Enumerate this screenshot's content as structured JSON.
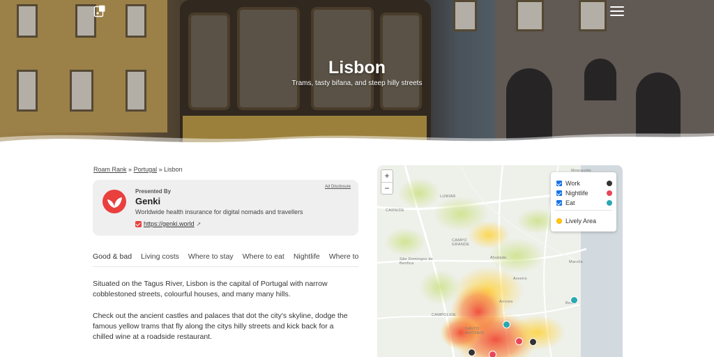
{
  "hero": {
    "title": "Lisbon",
    "subtitle": "Trams, tasty bifana, and steep hilly streets"
  },
  "breadcrumb": {
    "items": [
      "Roam Rank",
      "Portugal",
      "Lisbon"
    ],
    "separator": "»"
  },
  "sponsor": {
    "presented_by": "Presented By",
    "name": "Genki",
    "description": "Worldwide health insurance for digital nomads and travellers",
    "link_text": "https://genki.world",
    "ad_disclosure": "Ad Disclosure",
    "brand_color": "#e9403e"
  },
  "tabs": [
    "Good & bad",
    "Living costs",
    "Where to stay",
    "Where to eat",
    "Nightlife",
    "Where to work"
  ],
  "active_tab_color": "#2bb0b8",
  "content": {
    "p1": "Situated on the Tagus River, Lisbon is the capital of Portugal with narrow cobblestoned streets, colourful houses, and many many hills.",
    "p2": "Check out the ancient castles and palaces that dot the city's skyline, dodge the famous yellow trams that fly along the citys hilly streets and kick back for a chilled wine at a roadside restaurant."
  },
  "map": {
    "zoom_in": "+",
    "zoom_out": "−",
    "labels": [
      "Moscavide",
      "LUMIAR",
      "CARNIDE",
      "CAMPO GRANDE",
      "São Domingos de Benfica",
      "Alvalade",
      "Marvila",
      "Areeiro",
      "Arroios",
      "CAMPOLIDE",
      "Beato",
      "SANTO ANTÓNIO"
    ],
    "legend": {
      "work": "Work",
      "nightlife": "Nightlife",
      "eat": "Eat",
      "lively": "Lively Area"
    },
    "colors": {
      "work": "#333333",
      "nightlife": "#e8465a",
      "eat": "#2aa8b0"
    }
  }
}
